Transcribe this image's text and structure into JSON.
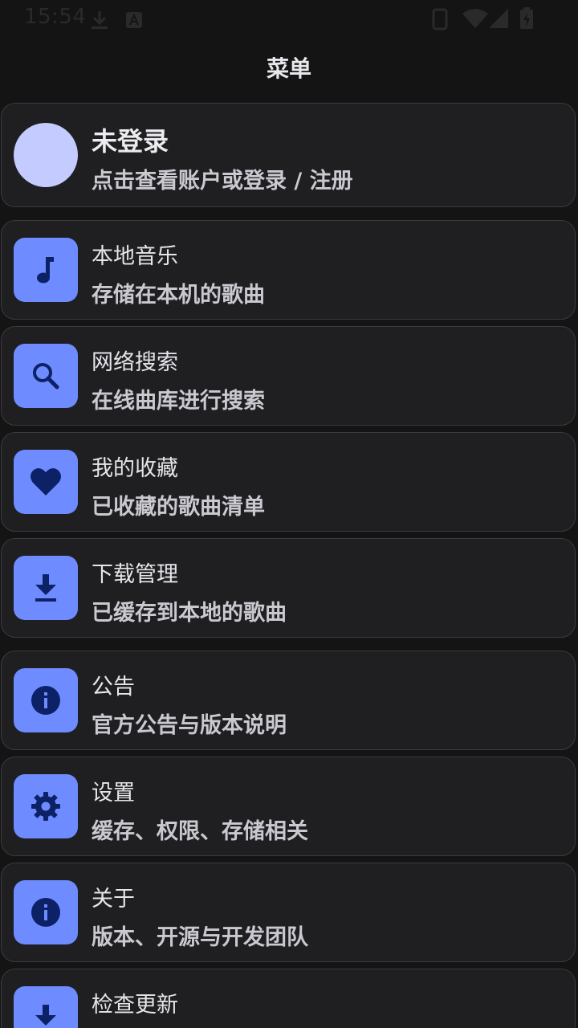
{
  "status_bar": {
    "time": "15:54",
    "icons": [
      "download-icon",
      "font-icon",
      "vibrate-icon",
      "wifi-icon",
      "signal-icon",
      "battery-charging-icon"
    ]
  },
  "header": {
    "title": "菜单"
  },
  "profile": {
    "title": "未登录",
    "subtitle": "点击查看账户或登录 / 注册"
  },
  "menu": {
    "items": [
      {
        "icon": "music-note-icon",
        "title": "本地音乐",
        "subtitle": "存储在本机的歌曲"
      },
      {
        "icon": "search-icon",
        "title": "网络搜索",
        "subtitle": "在线曲库进行搜索"
      },
      {
        "icon": "heart-icon",
        "title": "我的收藏",
        "subtitle": "已收藏的歌曲清单"
      },
      {
        "icon": "download-icon",
        "title": "下载管理",
        "subtitle": "已缓存到本地的歌曲"
      },
      {
        "icon": "info-icon",
        "title": "公告",
        "subtitle": "官方公告与版本说明"
      },
      {
        "icon": "gear-icon",
        "title": "设置",
        "subtitle": "缓存、权限、存储相关"
      },
      {
        "icon": "info-icon",
        "title": "关于",
        "subtitle": "版本、开源与开发团队"
      },
      {
        "icon": "download-icon",
        "title": "检查更新",
        "subtitle": ""
      }
    ]
  },
  "colors": {
    "background": "#141414",
    "card": "#1f1f22",
    "accent": "#6e8cff",
    "icon_fg": "#0d2266",
    "avatar": "#c3cbff"
  }
}
